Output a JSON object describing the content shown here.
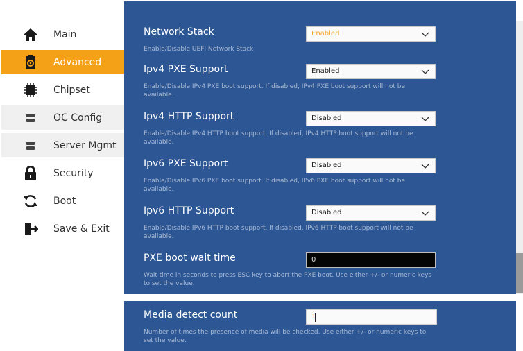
{
  "sidebar": {
    "items": [
      {
        "label": "Main",
        "icon": "home-icon",
        "state": "normal"
      },
      {
        "label": "Advanced",
        "icon": "clipboard-gear-icon",
        "state": "active"
      },
      {
        "label": "Chipset",
        "icon": "chip-icon",
        "state": "normal"
      },
      {
        "label": "OC Config",
        "icon": "stack-icon",
        "state": "alt"
      },
      {
        "label": "Server Mgmt",
        "icon": "stack-icon",
        "state": "alt"
      },
      {
        "label": "Security",
        "icon": "lock-icon",
        "state": "normal"
      },
      {
        "label": "Boot",
        "icon": "refresh-icon",
        "state": "normal"
      },
      {
        "label": "Save & Exit",
        "icon": "exit-door-icon",
        "state": "normal"
      }
    ]
  },
  "settings": [
    {
      "title": "Network Stack",
      "value": "Enabled",
      "help": "Enable/Disable UEFI Network Stack",
      "control": "select",
      "highlight": true
    },
    {
      "title": "Ipv4 PXE Support",
      "value": "Enabled",
      "help": "Enable/Disable IPv4 PXE boot support. If disabled, IPv4 PXE boot support will not be available.",
      "control": "select"
    },
    {
      "title": "Ipv4 HTTP Support",
      "value": "Disabled",
      "help": "Enable/Disable IPv4 HTTP boot support. If disabled, IPv4 HTTP boot support will not be available.",
      "control": "select"
    },
    {
      "title": "Ipv6 PXE Support",
      "value": "Disabled",
      "help": "Enable/Disable IPv6 PXE boot support. If disabled, IPv6 PXE boot support will not be available.",
      "control": "select"
    },
    {
      "title": "Ipv6 HTTP Support",
      "value": "Disabled",
      "help": "Enable/Disable IPv6 HTTP boot support. If disabled, IPv6 HTTP boot support will not be available.",
      "control": "select"
    },
    {
      "title": "PXE boot wait time",
      "value": "0",
      "help": "Wait time in seconds to press ESC key to abort the PXE boot. Use either +/- or numeric keys to set the value.",
      "control": "input-dark"
    }
  ],
  "media_detect": {
    "title": "Media detect count",
    "value": "1",
    "help": "Number of times the presence of media will be checked. Use either +/- or numeric keys to set the value."
  },
  "colors": {
    "accent": "#f5a117",
    "panel": "#2d5794",
    "help_text": "#a8b8d4",
    "value_highlight": "#f3a629"
  }
}
